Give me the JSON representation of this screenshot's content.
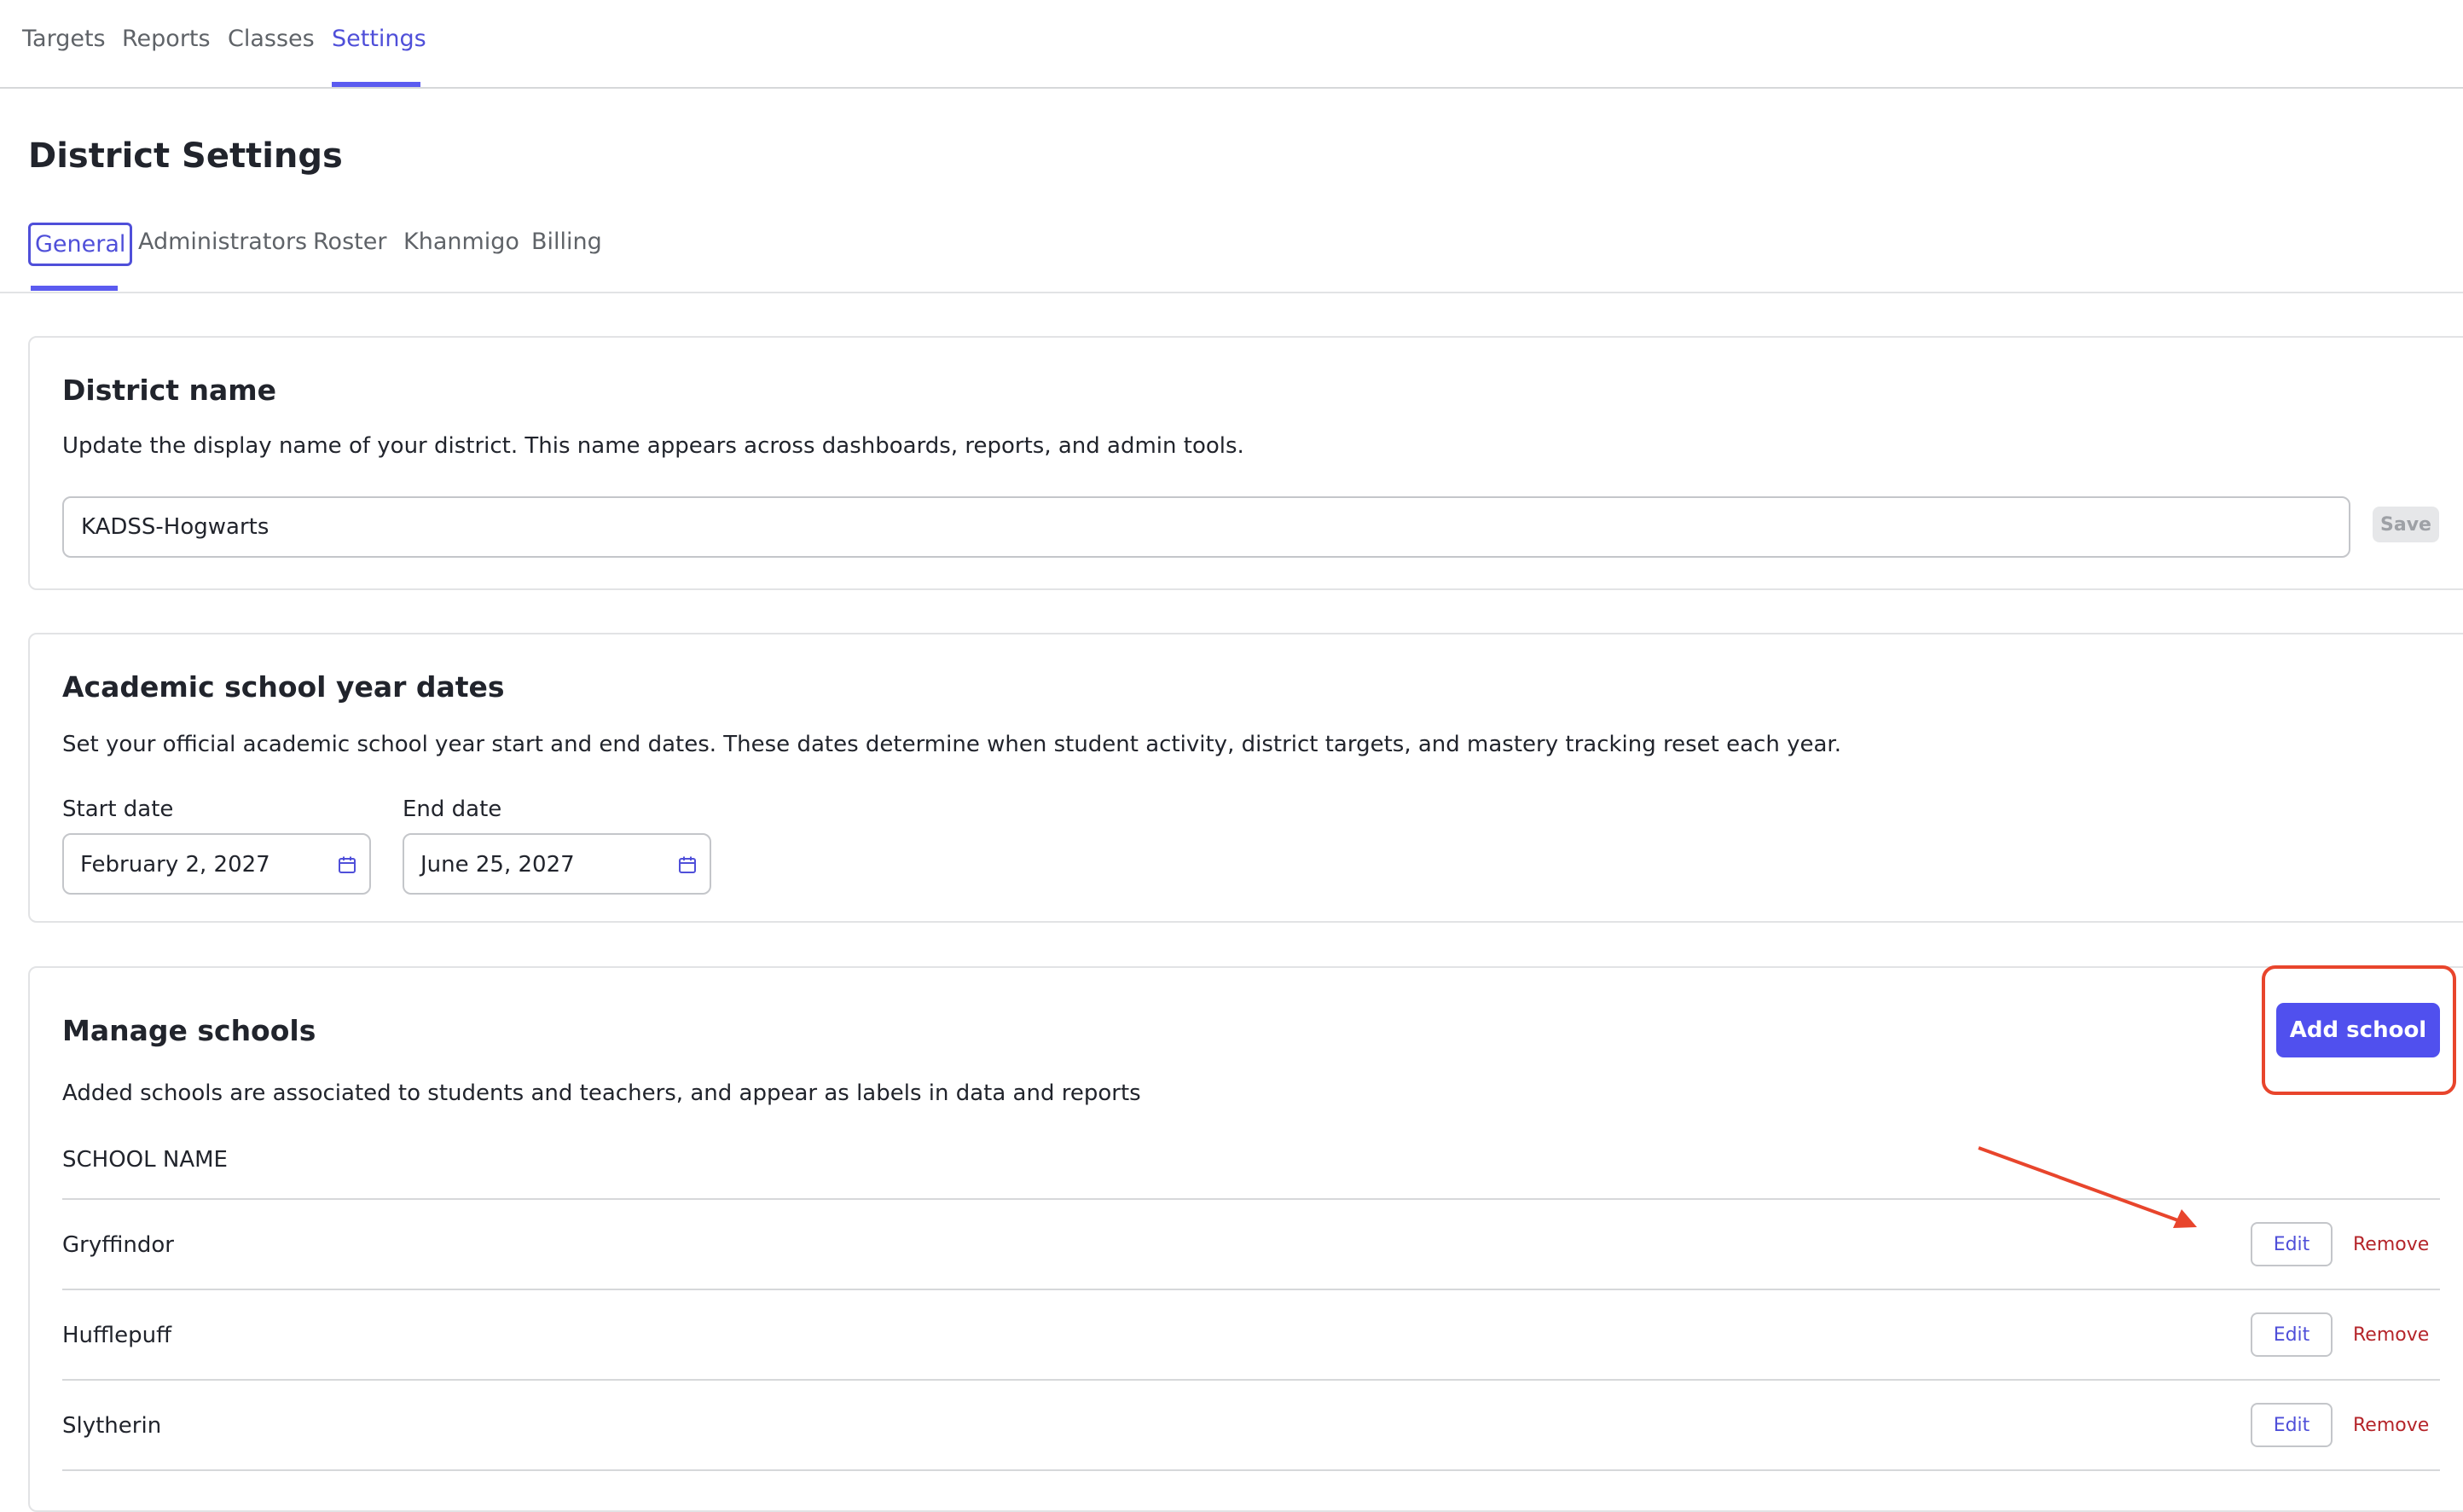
{
  "topnav": {
    "items": [
      {
        "label": "Targets",
        "active": false
      },
      {
        "label": "Reports",
        "active": false
      },
      {
        "label": "Classes",
        "active": false
      },
      {
        "label": "Settings",
        "active": true
      }
    ]
  },
  "page": {
    "title": "District Settings"
  },
  "subtabs": {
    "items": [
      {
        "label": "General",
        "active": true
      },
      {
        "label": "Administrators",
        "active": false
      },
      {
        "label": "Roster",
        "active": false
      },
      {
        "label": "Khanmigo",
        "active": false
      },
      {
        "label": "Billing",
        "active": false
      }
    ]
  },
  "district_name": {
    "title": "District name",
    "description": "Update the display name of your district. This name appears across dashboards, reports, and admin tools.",
    "value": "KADSS-Hogwarts",
    "save_label": "Save"
  },
  "academic_dates": {
    "title": "Academic school year dates",
    "description": "Set your official academic school year start and end dates. These dates determine when student activity, district targets, and mastery tracking reset each year.",
    "start_label": "Start date",
    "start_value": "February 2, 2027",
    "end_label": "End date",
    "end_value": "June 25, 2027",
    "icon": "calendar-icon"
  },
  "manage_schools": {
    "title": "Manage schools",
    "description": "Added schools are associated to students and teachers, and appear as labels in data and reports",
    "add_label": "Add school",
    "column_header": "SCHOOL NAME",
    "rows": [
      {
        "name": "Gryffindor",
        "edit_label": "Edit",
        "remove_label": "Remove"
      },
      {
        "name": "Hufflepuff",
        "edit_label": "Edit",
        "remove_label": "Remove"
      },
      {
        "name": "Slytherin",
        "edit_label": "Edit",
        "remove_label": "Remove"
      }
    ]
  },
  "colors": {
    "accent": "#5050ee",
    "accent_text": "#4f4fd9",
    "danger": "#b5252a",
    "annotation": "#e8452c"
  }
}
